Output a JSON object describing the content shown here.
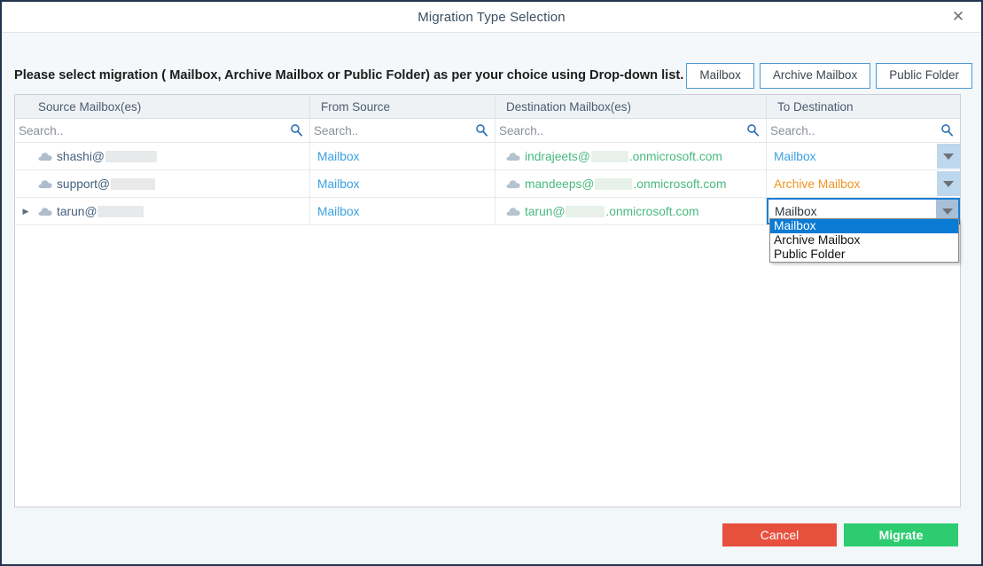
{
  "window": {
    "title": "Migration Type Selection",
    "close_label": "✕"
  },
  "instruction": {
    "text": "Please select migration ( Mailbox, Archive Mailbox or Public Folder) as per your choice using Drop-down list."
  },
  "type_buttons": [
    {
      "label": "Mailbox"
    },
    {
      "label": "Archive Mailbox"
    },
    {
      "label": "Public Folder"
    }
  ],
  "grid": {
    "columns": [
      {
        "header": "Source Mailbox(es)"
      },
      {
        "header": "From Source"
      },
      {
        "header": "Destination Mailbox(es)"
      },
      {
        "header": "To Destination"
      }
    ],
    "search_placeholder": "Search..",
    "search_values": [
      "",
      "",
      "",
      ""
    ],
    "rows": [
      {
        "expander": false,
        "source": "shashi@",
        "source_redacted_width": 58,
        "from_source": "Mailbox",
        "destination_prefix": "indrajeets@",
        "destination_redacted_width": 42,
        "destination_suffix": ".onmicrosoft.com",
        "to_destination": "Mailbox",
        "to_destination_color": "blue",
        "active": false
      },
      {
        "expander": false,
        "source": "support@",
        "source_redacted_width": 50,
        "from_source": "Mailbox",
        "destination_prefix": "mandeeps@",
        "destination_redacted_width": 42,
        "destination_suffix": ".onmicrosoft.com",
        "to_destination": "Archive Mailbox",
        "to_destination_color": "orange",
        "active": false
      },
      {
        "expander": true,
        "source": "tarun@",
        "source_redacted_width": 52,
        "from_source": "Mailbox",
        "destination_prefix": "tarun@",
        "destination_redacted_width": 44,
        "destination_suffix": ".onmicrosoft.com",
        "to_destination": "Mailbox",
        "to_destination_color": "dark",
        "active": true
      }
    ]
  },
  "dropdown": {
    "open": true,
    "items": [
      {
        "label": "Mailbox",
        "selected": true
      },
      {
        "label": "Archive Mailbox",
        "selected": false
      },
      {
        "label": "Public Folder",
        "selected": false
      }
    ]
  },
  "footer": {
    "cancel_label": "Cancel",
    "migrate_label": "Migrate"
  },
  "colors": {
    "cancel": "#e8503e",
    "migrate": "#2ecc71",
    "accent_blue": "#3ba0e0",
    "archive_orange": "#f0941f",
    "destination_green": "#49b97e",
    "selection_blue": "#0a7bd4"
  }
}
